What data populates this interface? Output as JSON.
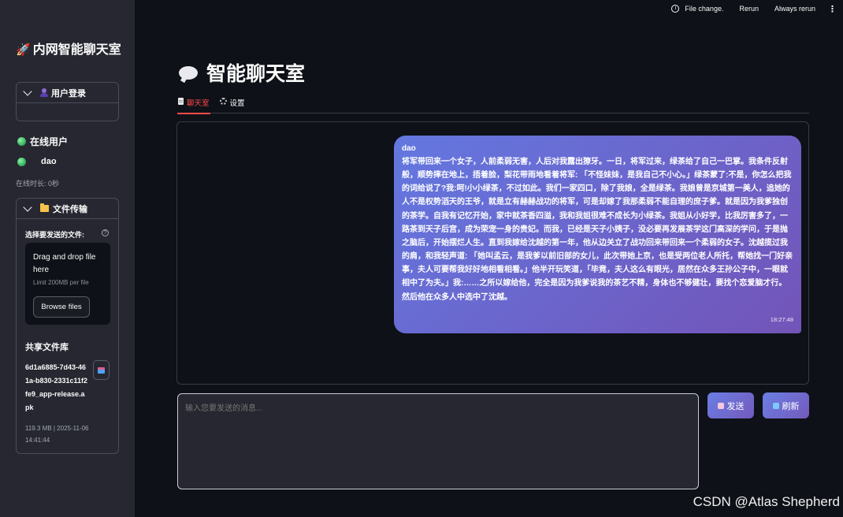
{
  "topbar": {
    "file_change": "File change.",
    "rerun": "Rerun",
    "always_rerun": "Always rerun",
    "menu": "⋮"
  },
  "sidebar": {
    "title": "内网智能聊天室",
    "title_icon": "🚀",
    "login": {
      "label": "用户登录"
    },
    "online": {
      "heading": "在线用户",
      "users": [
        "dao"
      ],
      "duration": "在线时长: 0秒"
    },
    "file_transfer": {
      "label": "文件传输",
      "select_label": "选择要发送的文件:",
      "dropzone_title": "Drag and drop file here",
      "dropzone_limit": "Limit 200MB per file",
      "browse_label": "Browse files",
      "library_title": "共享文件库",
      "file_name": "6d1a6885-7d43-461a-b830-2331c11f2fe9_app-release.apk",
      "file_meta": "119.3 MB | 2025-11-06 14:41:44"
    }
  },
  "main": {
    "title": "智能聊天室",
    "tabs": [
      {
        "label": "聊天室",
        "active": true
      },
      {
        "label": "设置",
        "active": false
      }
    ],
    "message": {
      "user": "dao",
      "text": "将军带回来一个女子，人前柔弱无害，人后对我露出獠牙。一日，将军过来，绿茶给了自己一巴掌。我条件反射般，顺势摔在地上，捂着脸，梨花带雨地看着将军: 「不怪妹妹，是我自己不小心。」绿茶蒙了:不是，你怎么把我的词给说了?我:呵!小小绿茶，不过如此。我们一家四口，除了我娘，全是绿茶。我娘曾是京城第一美人，追她的人不是权势滔天的王爷，就是立有赫赫战功的将军，可是却嫁了我那柔弱不能自理的庶子爹。就是因为我爹独创的茶学。自我有记忆开始，家中就茶香四溢，我和我姐很难不成长为小绿茶。我姐从小好学，比我厉害多了，一路茶到天子后宫，成为荣宠一身的贵妃。而我，已经是天子小姨子，没必要再发展茶学这门高深的学问，于是抛之脑后，开始摆烂人生。直到我嫁给沈越的第一年，他从边关立了战功回来带回来一个柔弱的女子。沈越揽过我的肩，和我轻声道: 「她叫孟云，是我爹以前旧部的女儿，此次带她上京，也是受两位老人所托，帮她找一门好亲事，夫人可要帮我好好地相看相看。」他半开玩笑道，「毕竟，夫人这么有眼光，居然在众多王孙公子中，一眼就相中了为夫。」我:……之所以嫁给他，完全是因为我爹说我的茶艺不精，身体也不够健壮，要找个恋爱脑才行。然后他在众多人中选中了沈越。",
      "time": "18:27:48"
    },
    "input_placeholder": "输入您要发送的消息...",
    "send_label": "发送",
    "refresh_label": "刷新"
  },
  "watermark": "CSDN @Atlas Shepherd",
  "colors": {
    "background": "#0e1117",
    "sidebar": "#262730",
    "accent": "#ff4b4b",
    "bubble_start": "#6378e0",
    "bubble_end": "#7354b8",
    "online_dot": "#2eaa55"
  },
  "icons": {
    "title": "rocket-icon",
    "login": "user-icon",
    "online": "green-dot-icon",
    "file": "folder-icon",
    "main_title": "speech-bubble-icon",
    "tab_chat": "document-icon",
    "tab_settings": "gear-icon",
    "send": "rocket-icon",
    "refresh": "refresh-icon"
  }
}
